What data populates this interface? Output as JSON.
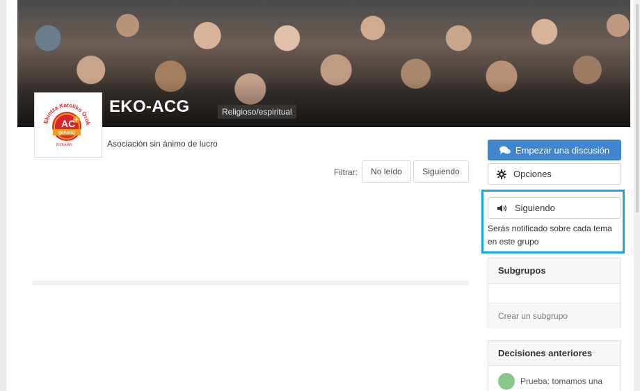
{
  "group": {
    "title": "EKO-ACG",
    "category": "Religioso/espiritual",
    "subtitle": "Asociación sin ánimo de lucro",
    "logo_text": {
      "ring": "Ekintza Katoliko Orokorra",
      "center": "AC",
      "band": "general",
      "bottom": "BIZKAIAN"
    }
  },
  "filters": {
    "label": "Filtrar:",
    "unread": "No leído",
    "following": "Siguiendo"
  },
  "sidebar": {
    "start_discussion": "Empezar una discusión",
    "options": "Opciones",
    "following_button": "Siguiendo",
    "follow_note": "Serás notificado sobre cada tema en este grupo",
    "subgroups": {
      "title": "Subgrupos",
      "create": "Crear un subgrupo"
    },
    "previous_decisions": {
      "title": "Decisiones anteriores",
      "items": [
        {
          "text": "Prueba: tomamos una"
        }
      ]
    }
  },
  "colors": {
    "primary": "#3f85d0",
    "highlight": "#1aa6e0",
    "logo_red": "#d7262c",
    "logo_orange": "#f29a24"
  }
}
